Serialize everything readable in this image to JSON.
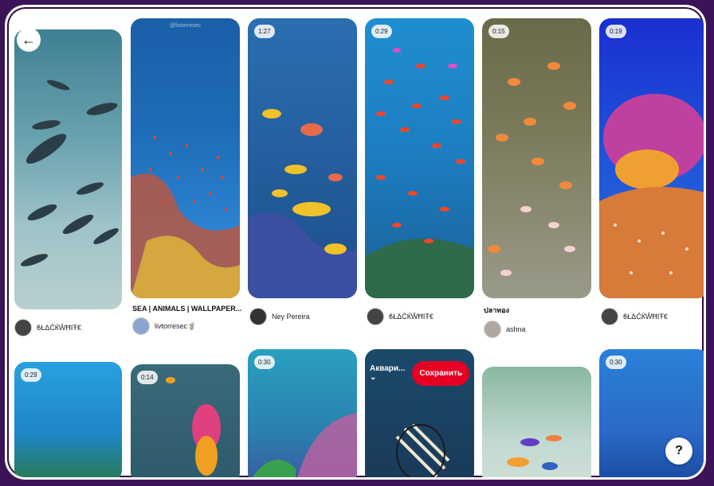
{
  "pins": [
    {
      "author": "ϐŁΔĆЌŴĦΙŦ€"
    },
    {
      "watermark": "@livtorresec",
      "title": "SEA | ANIMALS | WALLPAPER...",
      "author": "livtorresec🧋"
    },
    {
      "duration": "1:27",
      "author": "Ney Pereira"
    },
    {
      "duration": "0:29",
      "author": "ϐŁΔĆЌŴĦΙŦ€"
    },
    {
      "duration": "0:15",
      "title": "ปลาทอง",
      "author": "ashna"
    },
    {
      "duration": "0:19",
      "author": "ϐŁΔĆЌŴĦΙŦ€"
    }
  ],
  "row2": [
    {
      "duration": "0:29"
    },
    {
      "duration": "0:14"
    },
    {
      "duration": "0:30"
    },
    {
      "board_label": "Аквари...",
      "save_label": "Сохранить"
    },
    {},
    {
      "duration": "0:30"
    }
  ],
  "help_label": "?",
  "colors": {
    "save": "#e60023",
    "frame_bg": "#3a1456"
  }
}
